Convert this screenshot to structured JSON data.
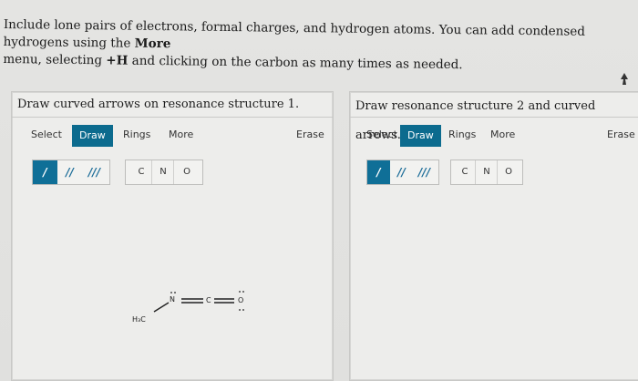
{
  "instructions": {
    "line1_pre": "Include lone pairs of electrons, formal charges, and hydrogen atoms. You can add condensed hydrogens using the ",
    "more_bold": "More",
    "line2_pre": "menu, selecting ",
    "plus_h_bold": "+H",
    "line2_post": " and clicking on the carbon as many times as needed."
  },
  "panels": [
    {
      "title": "Draw curved arrows on resonance structure 1.",
      "toolbar": {
        "select": "Select",
        "draw": "Draw",
        "rings": "Rings",
        "more": "More",
        "erase": "Erase"
      },
      "bonds": [
        "/",
        "//",
        "///"
      ],
      "atoms": [
        "C",
        "N",
        "O"
      ],
      "molecule": {
        "methyl": "H₃C",
        "n_atom": "N",
        "c_atom": "C",
        "o_atom": "O"
      }
    },
    {
      "title": "Draw resonance structure 2 and curved arrows.",
      "toolbar": {
        "select": "Select",
        "draw": "Draw",
        "rings": "Rings",
        "more": "More",
        "erase": "Erase"
      },
      "bonds": [
        "/",
        "//",
        "///"
      ],
      "atoms": [
        "C",
        "N",
        "O"
      ]
    }
  ],
  "colors": {
    "accent": "#0c6b8e",
    "bond_icon": "#1e6e99"
  }
}
